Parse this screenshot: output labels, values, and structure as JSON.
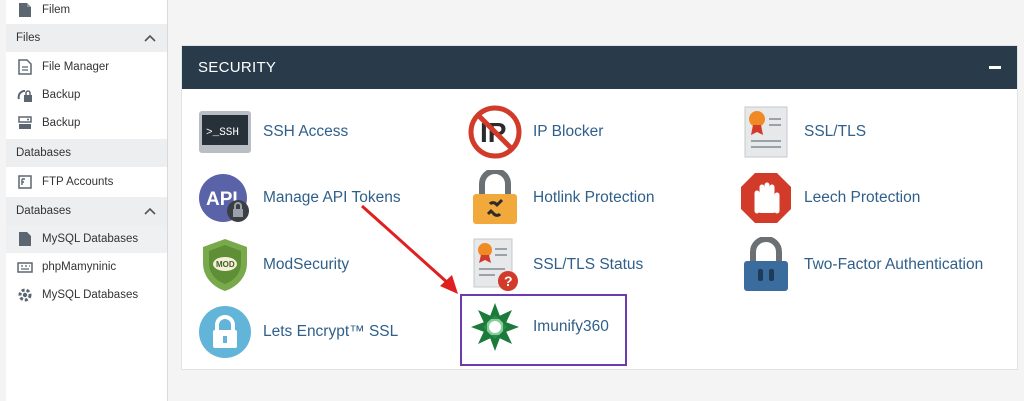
{
  "sidebar": {
    "top_item": {
      "label": "Filem"
    },
    "files_header": "Files",
    "files_items": [
      {
        "label": "File Manager"
      },
      {
        "label": "Backup"
      },
      {
        "label": "Backup"
      }
    ],
    "databases_header_1": "Databases",
    "db1_items": [
      {
        "label": "FTP Accounts"
      }
    ],
    "databases_header_2": "Databases",
    "db2_items": [
      {
        "label": "MySQL Databases"
      },
      {
        "label": "phpMamyninic"
      },
      {
        "label": "MySQL Databases"
      }
    ]
  },
  "panel": {
    "title": "SECURITY",
    "tools": [
      {
        "label": "SSH Access",
        "icon": "terminal-icon",
        "icon_text": ">_SSH"
      },
      {
        "label": "IP Blocker",
        "icon": "ip-blocker-icon",
        "icon_text": "IP"
      },
      {
        "label": "SSL/TLS",
        "icon": "certificate-icon"
      },
      {
        "label": "Manage API Tokens",
        "icon": "api-icon",
        "icon_text": "API"
      },
      {
        "label": "Hotlink Protection",
        "icon": "lock-link-icon"
      },
      {
        "label": "Leech Protection",
        "icon": "hand-stop-icon"
      },
      {
        "label": "ModSecurity",
        "icon": "shield-icon",
        "icon_text": "MOD"
      },
      {
        "label": "SSL/TLS Status",
        "icon": "certificate-status-icon"
      },
      {
        "label": "Two-Factor Authentication",
        "icon": "padlock-icon"
      },
      {
        "label": "Lets Encrypt™ SSL",
        "icon": "lets-encrypt-icon"
      },
      {
        "label": "Imunify360",
        "icon": "imunify-icon"
      }
    ]
  },
  "colors": {
    "header_bg": "#293a4a",
    "link": "#2f5f8a",
    "highlight": "#6a3cb0",
    "arrow": "#e02020"
  }
}
